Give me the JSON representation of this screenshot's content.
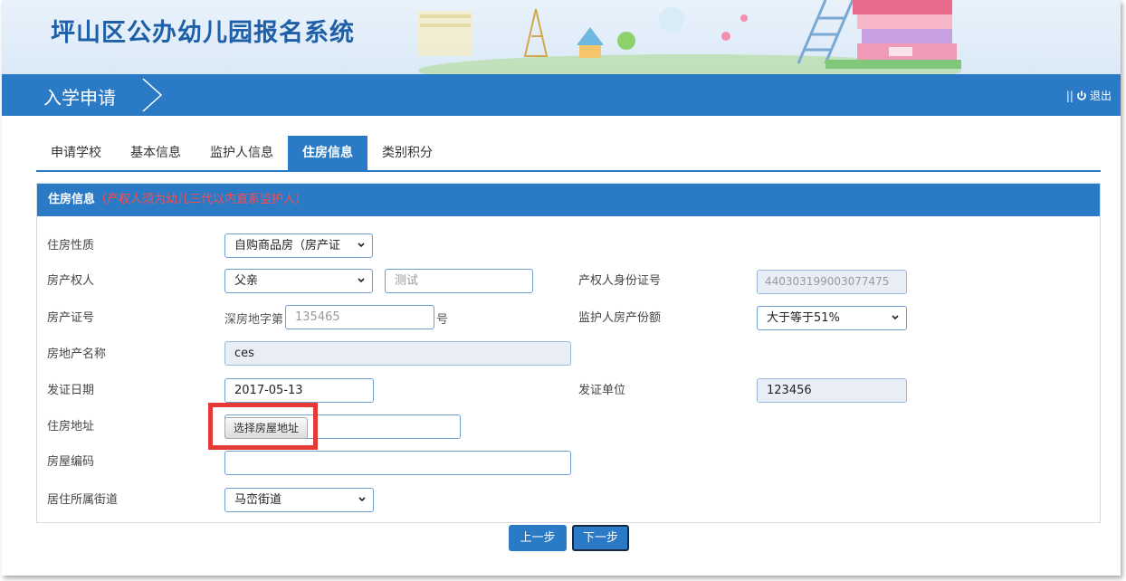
{
  "header": {
    "site_title": "坪山区公办幼儿园报名系统"
  },
  "nav": {
    "title": "入学申请",
    "logout_label": "退出",
    "separator": "||"
  },
  "tabs": [
    {
      "label": "申请学校",
      "active": false
    },
    {
      "label": "基本信息",
      "active": false
    },
    {
      "label": "监护人信息",
      "active": false
    },
    {
      "label": "住房信息",
      "active": true
    },
    {
      "label": "类别积分",
      "active": false
    }
  ],
  "panel": {
    "title": "住房信息",
    "note": "（产权人须为幼儿三代以内直系监护人）"
  },
  "form": {
    "housing_type": {
      "label": "住房性质",
      "value": "自购商品房（房产证"
    },
    "owner": {
      "label": "房产权人",
      "value": "父亲",
      "name_value": "测试"
    },
    "owner_id": {
      "label": "产权人身份证号",
      "value": "440303199003077475"
    },
    "cert_no": {
      "label": "房产证号",
      "prefix": "深房地字第",
      "value": "135465",
      "suffix": "号"
    },
    "guardian_share": {
      "label": "监护人房产份额",
      "value": "大于等于51%"
    },
    "estate_name": {
      "label": "房地产名称",
      "value": "ces"
    },
    "issue_date": {
      "label": "发证日期",
      "value": "2017-05-13"
    },
    "issuer": {
      "label": "发证单位",
      "value": "123456"
    },
    "address": {
      "label": "住房地址",
      "button_label": "选择房屋地址"
    },
    "house_code": {
      "label": "房屋编码",
      "value": ""
    },
    "street": {
      "label": "居住所属街道",
      "value": "马峦街道"
    }
  },
  "buttons": {
    "prev": "上一步",
    "next": "下一步"
  },
  "colors": {
    "primary": "#2a7ac6",
    "highlight": "#e53935",
    "note": "#ff4b4b"
  }
}
